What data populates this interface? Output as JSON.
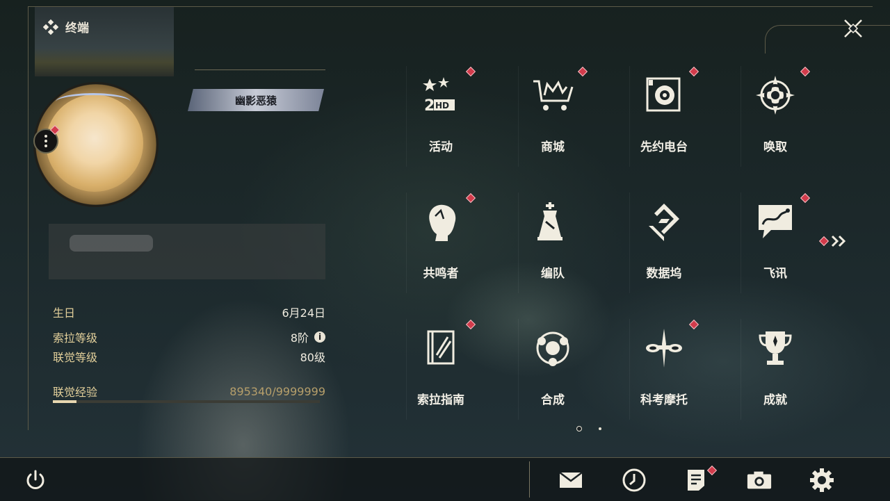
{
  "header": {
    "title": "终端"
  },
  "profile": {
    "nickname": "幽影恶猿",
    "stats": [
      {
        "label": "生日",
        "value": "6月24日"
      },
      {
        "label": "索拉等级",
        "value": "8阶"
      },
      {
        "label": "联觉等级",
        "value": "80级"
      }
    ],
    "exp": {
      "label": "联觉经验",
      "value": "895340/9999999",
      "fraction": 0.0895
    }
  },
  "menu": {
    "items": [
      {
        "label": "活动",
        "icon": "event-2hd-icon",
        "badge": true
      },
      {
        "label": "商城",
        "icon": "shop-cart-icon",
        "badge": true
      },
      {
        "label": "先约电台",
        "icon": "radio-speaker-icon",
        "badge": true
      },
      {
        "label": "唤取",
        "icon": "summon-compass-icon",
        "badge": true
      },
      {
        "label": "共鸣者",
        "icon": "resonator-head-icon",
        "badge": true
      },
      {
        "label": "编队",
        "icon": "team-chess-icon",
        "badge": false
      },
      {
        "label": "数据坞",
        "icon": "data-dock-icon",
        "badge": false
      },
      {
        "label": "飞讯",
        "icon": "message-bubble-icon",
        "badge": true
      },
      {
        "label": "索拉指南",
        "icon": "guide-book-icon",
        "badge": true
      },
      {
        "label": "合成",
        "icon": "synthesis-icon",
        "badge": false
      },
      {
        "label": "科考摩托",
        "icon": "motorcycle-icon",
        "badge": true
      },
      {
        "label": "成就",
        "icon": "trophy-icon",
        "badge": false
      }
    ],
    "page_count": 2,
    "current_page": 1
  },
  "colors": {
    "accent": "#e2cf9a",
    "badge": "#d23b4b",
    "frame": "#5d5a48"
  }
}
